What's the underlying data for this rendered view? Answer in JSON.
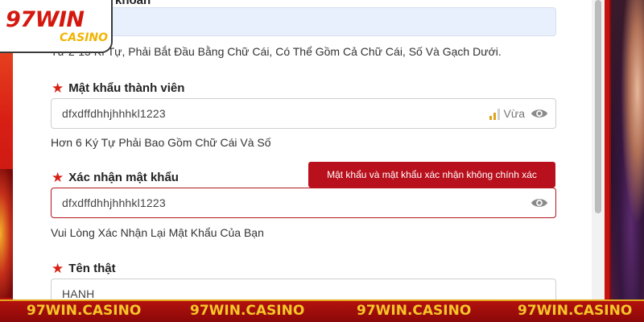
{
  "logo": {
    "main": "97WIN",
    "sub": "CASINO"
  },
  "username": {
    "label_partial": "khoản",
    "hint": "Từ 2-15 Kí Tự, Phải Bắt Đầu Bằng Chữ Cái, Có Thể Gồm Cả Chữ Cái, Số Và Gạch Dưới."
  },
  "password": {
    "label": "Mật khẩu thành viên",
    "value": "dfxdffdhhjhhhkl1223",
    "strength_label": "Vừa",
    "strength_level": 2,
    "strength_max": 3,
    "hint": "Hơn 6 Ký Tự Phải Bao Gồm Chữ Cái Và Số"
  },
  "confirm_password": {
    "label": "Xác nhận mật khẩu",
    "value": "dfxdffdhhjhhhkl1223",
    "error_tooltip": "Mật khẩu và mật khẩu xác nhận không chính xác",
    "hint": "Vui Lòng Xác Nhận Lại Mật Khẩu Của Bạn"
  },
  "real_name": {
    "label": "Tên thật",
    "value": "HANH"
  },
  "footer": {
    "items": [
      "97WIN.CASINO",
      "97WIN.CASINO",
      "97WIN.CASINO",
      "97WIN.CASINO"
    ]
  },
  "colors": {
    "accent_red": "#d81f14",
    "error_red": "#b8101c",
    "footer_gold": "#f6c628",
    "autofill_bg": "#e8f0fe"
  },
  "icons": [
    "star-icon",
    "eye-icon",
    "signal-bars-icon"
  ]
}
